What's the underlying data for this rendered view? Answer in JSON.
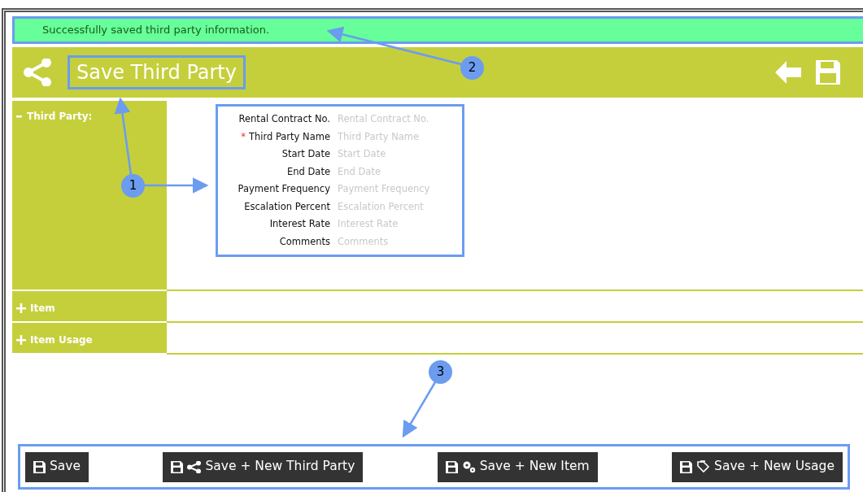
{
  "message": "Successfully saved third party information.",
  "header": {
    "title": "Save Third Party"
  },
  "sections": [
    {
      "label": "Third Party:",
      "expanded": true,
      "fields": [
        {
          "label": "Rental Contract No.",
          "placeholder": "Rental Contract No.",
          "required": false
        },
        {
          "label": "Third Party Name",
          "placeholder": "Third Party Name",
          "required": true
        },
        {
          "label": "Start Date",
          "placeholder": "Start Date",
          "required": false
        },
        {
          "label": "End Date",
          "placeholder": "End Date",
          "required": false
        },
        {
          "label": "Payment Frequency",
          "placeholder": "Payment Frequency",
          "required": false
        },
        {
          "label": "Escalation Percent",
          "placeholder": "Escalation Percent",
          "required": false
        },
        {
          "label": "Interest Rate",
          "placeholder": "Interest Rate",
          "required": false
        },
        {
          "label": "Comments",
          "placeholder": "Comments",
          "required": false
        }
      ]
    },
    {
      "label": "Item",
      "expanded": false
    },
    {
      "label": "Item Usage",
      "expanded": false
    }
  ],
  "buttons": [
    {
      "label": "Save",
      "kind": "save"
    },
    {
      "label": "Save + New Third Party",
      "kind": "share"
    },
    {
      "label": "Save + New Item",
      "kind": "gear"
    },
    {
      "label": "Save + New Usage",
      "kind": "usage"
    }
  ],
  "callouts": [
    "1",
    "2",
    "3"
  ],
  "required_mark": "*"
}
